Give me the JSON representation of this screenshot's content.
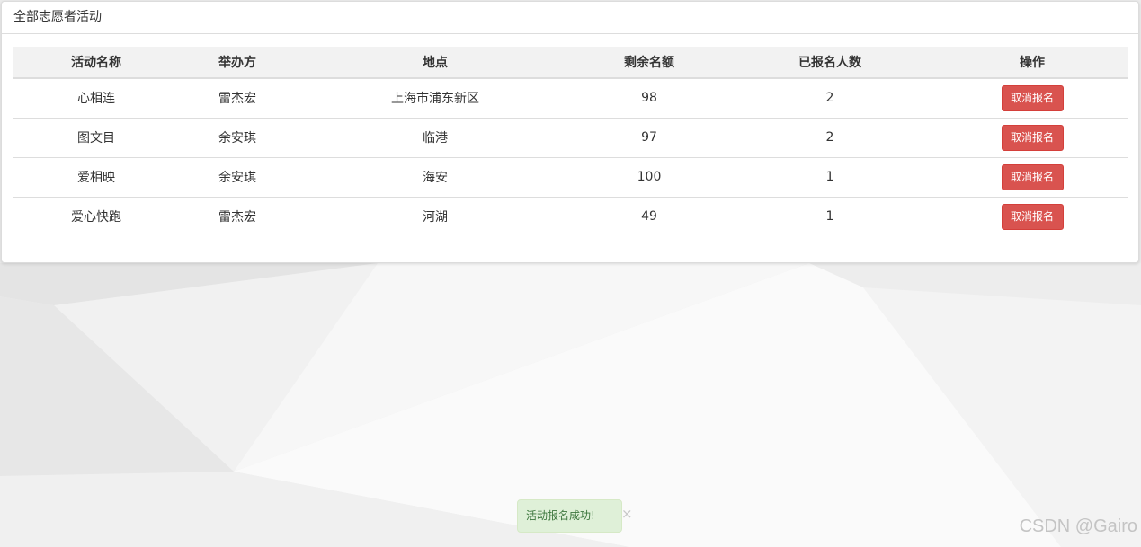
{
  "panel": {
    "title": "全部志愿者活动"
  },
  "table": {
    "headers": [
      "活动名称",
      "举办方",
      "地点",
      "剩余名额",
      "已报名人数",
      "操作"
    ],
    "rows": [
      {
        "name": "心相连",
        "host": "雷杰宏",
        "location": "上海市浦东新区",
        "remaining": "98",
        "enrolled": "2",
        "action": "取消报名"
      },
      {
        "name": "图文目",
        "host": "余安琪",
        "location": "临港",
        "remaining": "97",
        "enrolled": "2",
        "action": "取消报名"
      },
      {
        "name": "爱相映",
        "host": "余安琪",
        "location": "海安",
        "remaining": "100",
        "enrolled": "1",
        "action": "取消报名"
      },
      {
        "name": "爱心快跑",
        "host": "雷杰宏",
        "location": "河湖",
        "remaining": "49",
        "enrolled": "1",
        "action": "取消报名"
      }
    ]
  },
  "toast": {
    "message": "活动报名成功!",
    "close_glyph": "×"
  },
  "watermark": "CSDN @Gairo",
  "colors": {
    "danger": "#d9534f",
    "success_bg": "#dff0d8",
    "success_text": "#3c763d"
  }
}
